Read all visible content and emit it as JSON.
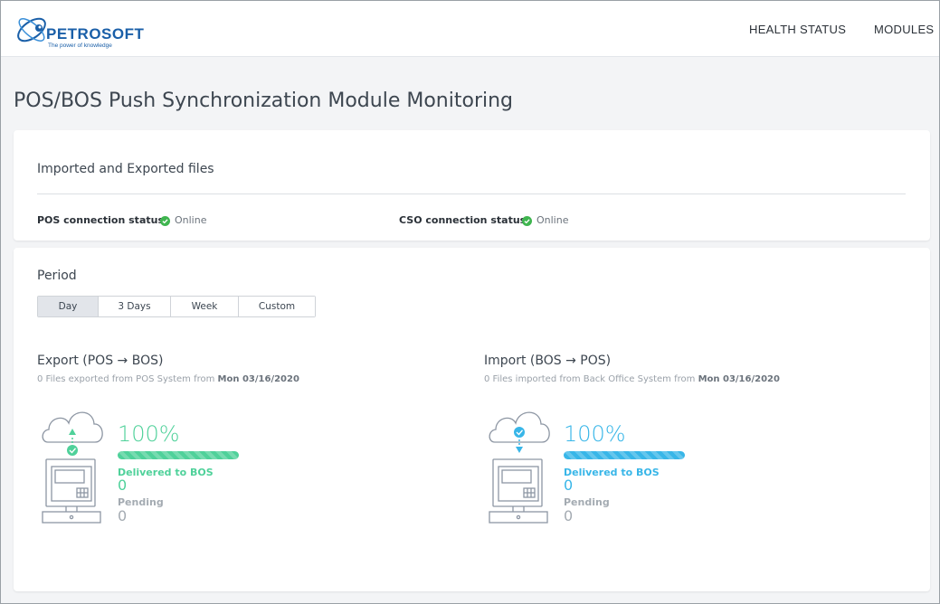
{
  "header": {
    "logo_text": "PETROSOFT",
    "logo_tagline": "The power of knowledge",
    "nav": [
      "HEALTH STATUS",
      "MODULES"
    ]
  },
  "page": {
    "title": "POS/BOS Push Synchronization Module Monitoring"
  },
  "files_card": {
    "title": "Imported and Exported files",
    "pos_label": "POS connection status",
    "pos_value": "Online",
    "cso_label": "CSO connection status",
    "cso_value": "Online",
    "status_color": "#3fb54f"
  },
  "period": {
    "title": "Period",
    "options": [
      "Day",
      "3 Days",
      "Week",
      "Custom"
    ],
    "selected": "Day"
  },
  "export": {
    "title": "Export (POS → BOS)",
    "subtitle_prefix": "0 Files exported from POS System from ",
    "subtitle_date": "Mon 03/16/2020",
    "percent": "100%",
    "progress": 1.0,
    "delivered_label": "Delivered to BOS",
    "delivered_value": "0",
    "pending_label": "Pending",
    "pending_value": "0",
    "color": "#4fd19a"
  },
  "import": {
    "title": "Import (BOS → POS)",
    "subtitle_prefix": "0 Files imported from Back Office System from ",
    "subtitle_date": "Mon 03/16/2020",
    "percent": "100%",
    "progress": 1.0,
    "delivered_label": "Delivered to BOS",
    "delivered_value": "0",
    "pending_label": "Pending",
    "pending_value": "0",
    "color": "#38b6e8"
  },
  "icons": {
    "status": "check-circle-icon",
    "cloud": "cloud-icon",
    "pos_terminal": "pos-terminal-icon"
  }
}
